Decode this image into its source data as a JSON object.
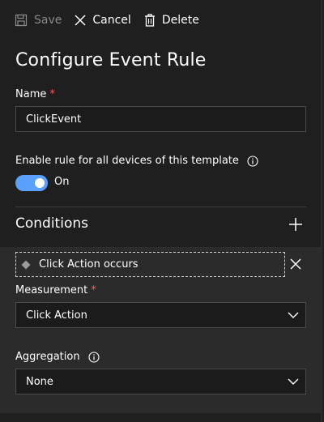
{
  "toolbar": {
    "save_label": "Save",
    "cancel_label": "Cancel",
    "delete_label": "Delete"
  },
  "page_title": "Configure Event Rule",
  "name_field": {
    "label": "Name",
    "required_mark": "*",
    "value": "ClickEvent"
  },
  "enable_rule": {
    "label": "Enable rule for all devices of this template",
    "toggle_state": "On"
  },
  "conditions": {
    "title": "Conditions",
    "chip_label": "Click Action occurs",
    "measurement": {
      "label": "Measurement",
      "required_mark": "*",
      "selected": "Click Action"
    },
    "aggregation": {
      "label": "Aggregation",
      "selected": "None"
    }
  },
  "colors": {
    "accent": "#5aa0ff",
    "required": "#ff5a5a",
    "panel_bg": "#1f1f1f",
    "conditions_bg": "#2b2b2b"
  }
}
